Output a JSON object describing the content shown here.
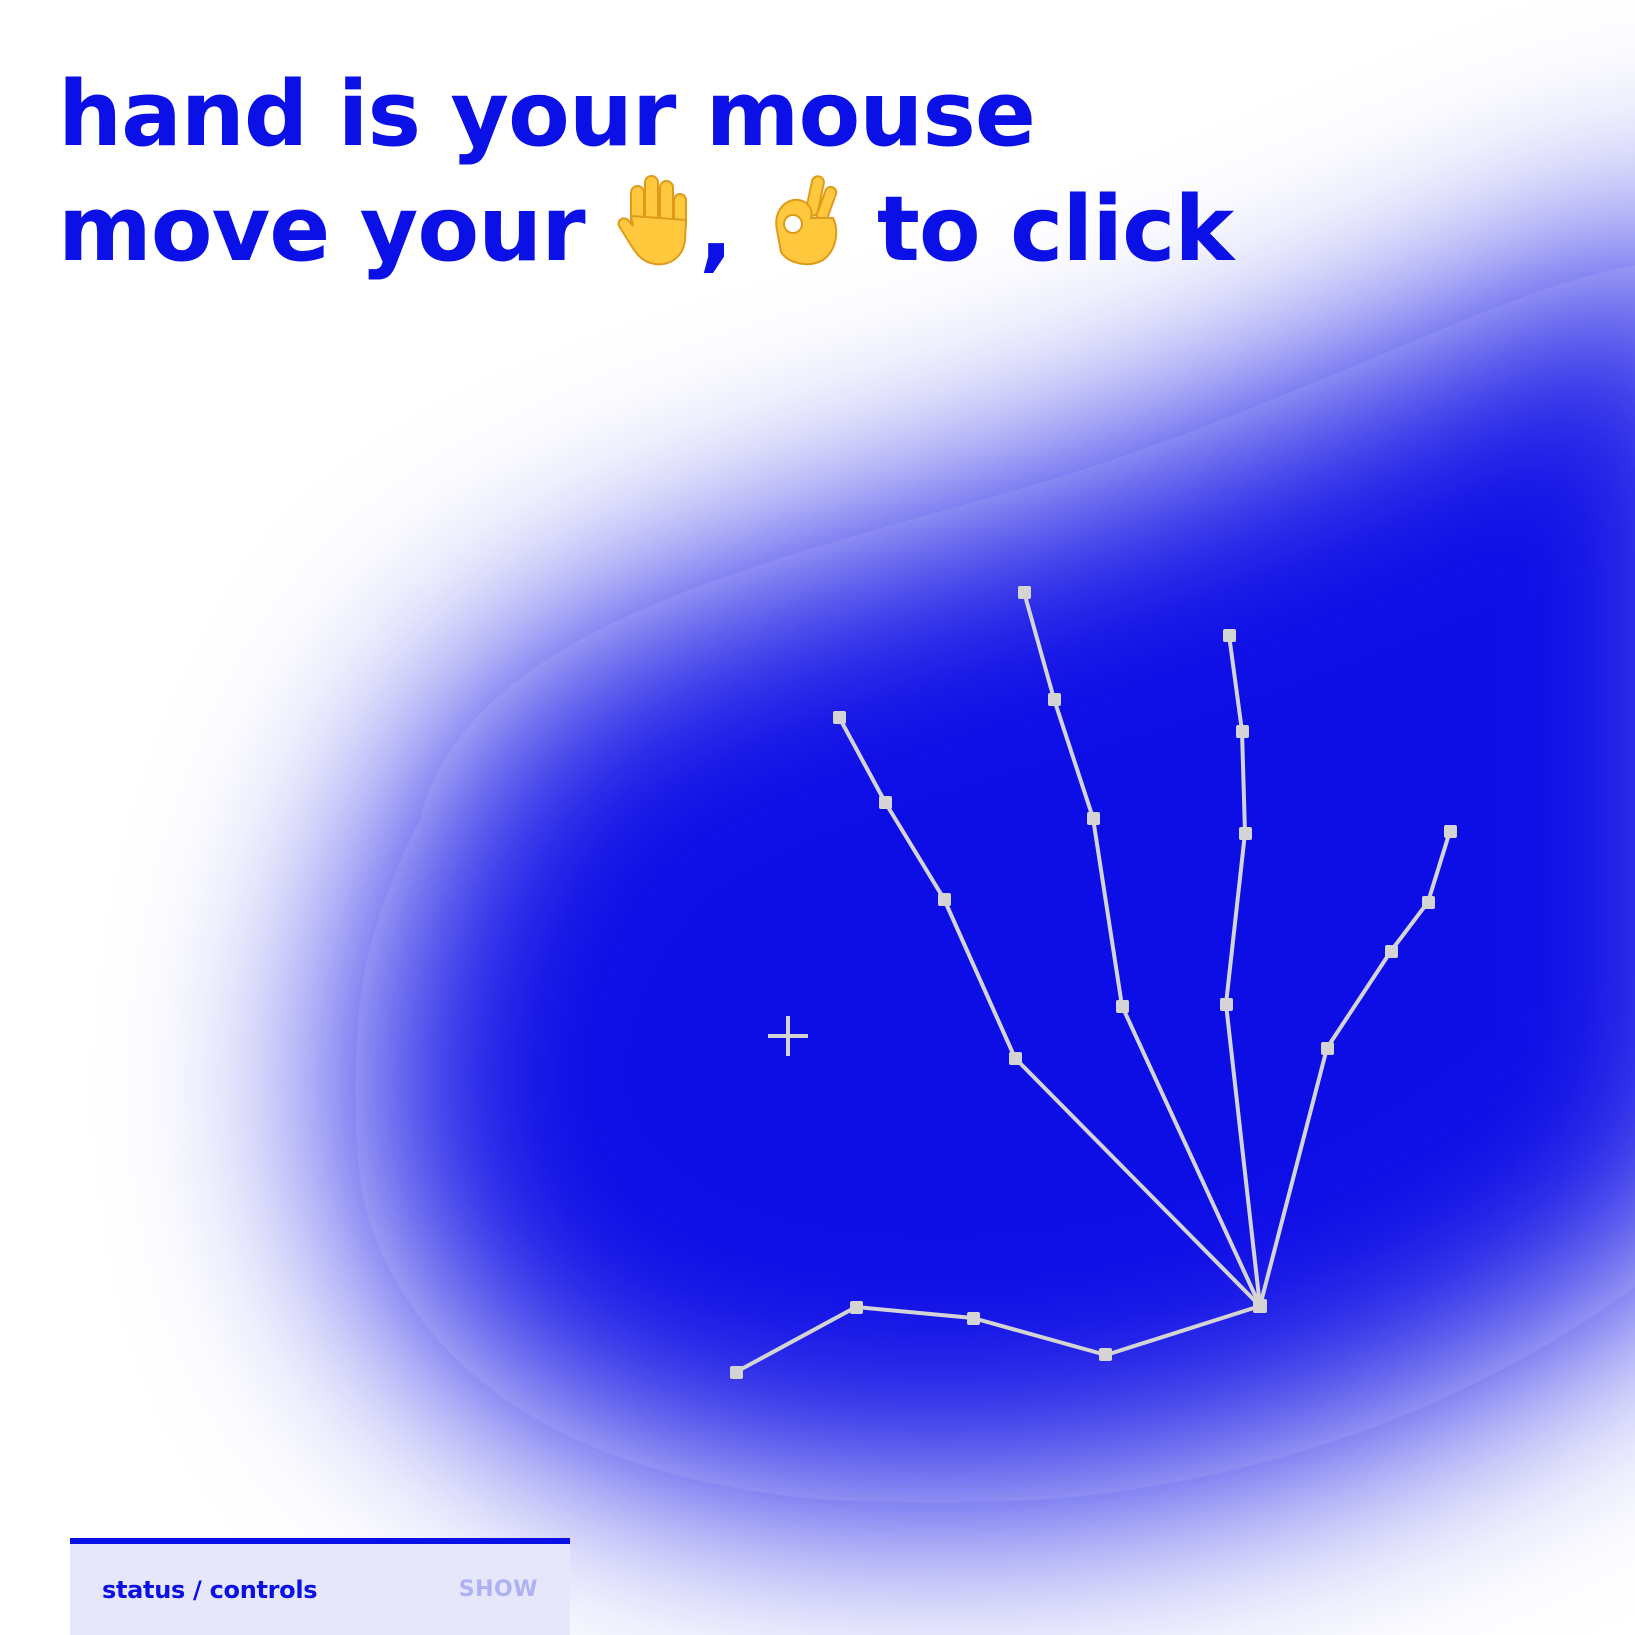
{
  "headline": {
    "line1": "hand is your mouse",
    "line2_prefix": "move your",
    "line2_separator": ",",
    "line2_suffix": "to click",
    "emoji_move": "raised-hand",
    "emoji_click": "ok-hand"
  },
  "colors": {
    "accent": "#0a10e6",
    "background": "#ffffff",
    "skeleton": "#d4d4d4",
    "panel_bg": "#e6e7fb",
    "panel_toggle": "#aeb1f3"
  },
  "cursor": {
    "icon": "crosshair-icon"
  },
  "status_panel": {
    "title": "status / controls",
    "toggle_label": "SHOW"
  }
}
